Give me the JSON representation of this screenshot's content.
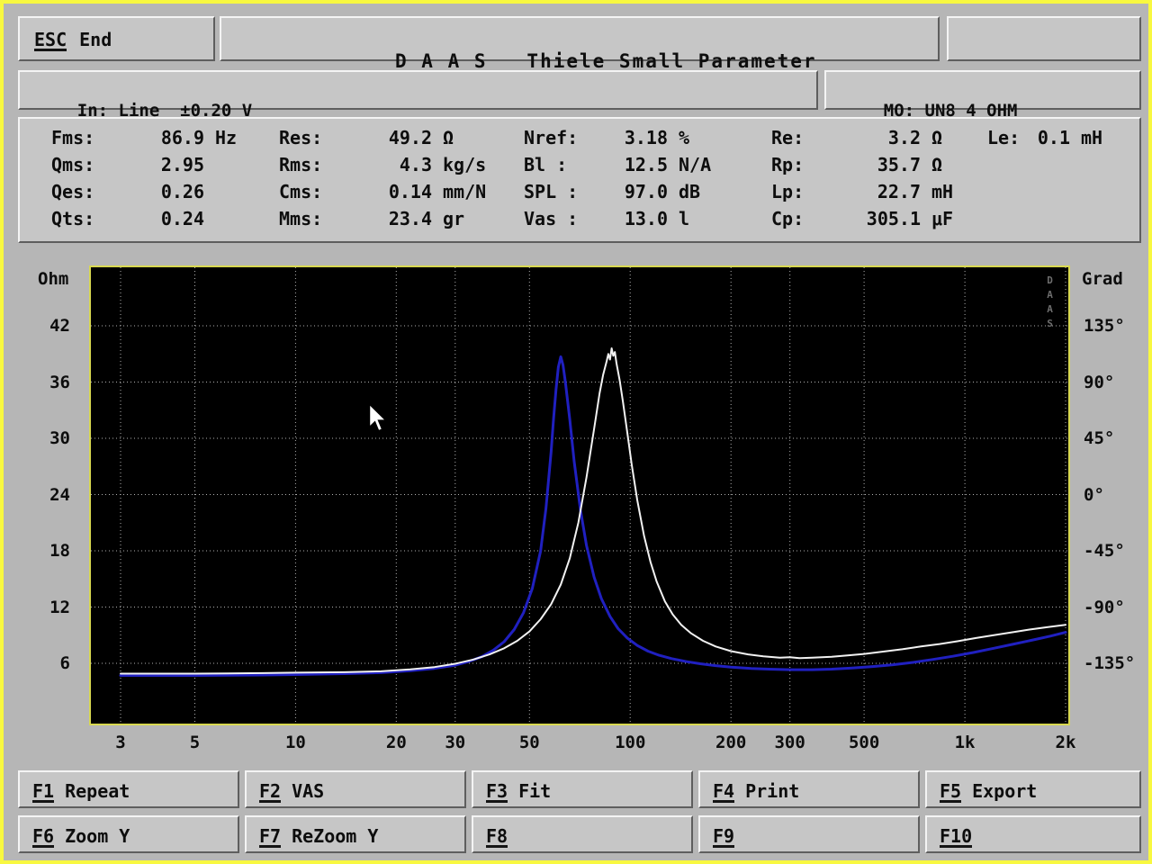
{
  "top": {
    "esc_key": "ESC",
    "esc_label": "End",
    "title": "D A A S   Thiele Small Parameter"
  },
  "status": {
    "input": "In: Line  ±0.20 V",
    "mo_key": "MO",
    "mo_rest": ": UN8 4 OHM"
  },
  "parameters": {
    "rows": [
      [
        {
          "label": "Fms:",
          "value": "86.9",
          "unit": "Hz"
        },
        {
          "label": "Res:",
          "value": "49.2",
          "unit": "Ω"
        },
        {
          "label": "Nref:",
          "value": "3.18",
          "unit": "%"
        },
        {
          "label": "Re:",
          "value": "3.2",
          "unit": "Ω"
        },
        {
          "label": "Le:",
          "value": "0.1",
          "unit": "mH"
        }
      ],
      [
        {
          "label": "Qms:",
          "value": "2.95",
          "unit": ""
        },
        {
          "label": "Rms:",
          "value": "4.3",
          "unit": "kg/s"
        },
        {
          "label": "Bl :",
          "value": "12.5",
          "unit": "N/A"
        },
        {
          "label": "Rp:",
          "value": "35.7",
          "unit": "Ω"
        }
      ],
      [
        {
          "label": "Qes:",
          "value": "0.26",
          "unit": ""
        },
        {
          "label": "Cms:",
          "value": "0.14",
          "unit": "mm/N"
        },
        {
          "label": "SPL :",
          "value": "97.0",
          "unit": "dB"
        },
        {
          "label": "Lp:",
          "value": "22.7",
          "unit": "mH"
        }
      ],
      [
        {
          "label": "Qts:",
          "value": "0.24",
          "unit": ""
        },
        {
          "label": "Mms:",
          "value": "23.4",
          "unit": "gr"
        },
        {
          "label": "Vas :",
          "value": "13.0",
          "unit": "l"
        },
        {
          "label": "Cp:",
          "value": "305.1",
          "unit": "μF"
        }
      ]
    ]
  },
  "fkeys": {
    "row1": [
      {
        "key": "F1",
        "label": "Repeat"
      },
      {
        "key": "F2",
        "label": "VAS"
      },
      {
        "key": "F3",
        "label": "Fit"
      },
      {
        "key": "F4",
        "label": "Print"
      },
      {
        "key": "F5",
        "label": "Export"
      }
    ],
    "row2": [
      {
        "key": "F6",
        "label": "Zoom Y"
      },
      {
        "key": "F7",
        "label": "ReZoom Y"
      },
      {
        "key": "F8",
        "label": ""
      },
      {
        "key": "F9",
        "label": ""
      },
      {
        "key": "F10",
        "label": ""
      }
    ]
  },
  "chart_data": {
    "type": "line",
    "x_scale": "log",
    "x_min": 3,
    "x_max": 2000,
    "x_ticks": [
      {
        "label": "3",
        "value": 3
      },
      {
        "label": "5",
        "value": 5
      },
      {
        "label": "10",
        "value": 10
      },
      {
        "label": "20",
        "value": 20
      },
      {
        "label": "30",
        "value": 30
      },
      {
        "label": "50",
        "value": 50
      },
      {
        "label": "100",
        "value": 100
      },
      {
        "label": "200",
        "value": 200
      },
      {
        "label": "300",
        "value": 300
      },
      {
        "label": "500",
        "value": 500
      },
      {
        "label": "1k",
        "value": 1000
      },
      {
        "label": "2k",
        "value": 2000
      }
    ],
    "y_left": {
      "label": "Ohm",
      "ticks": [
        42,
        36,
        30,
        24,
        18,
        12,
        6
      ],
      "ylim": [
        0,
        48.2
      ]
    },
    "y_right": {
      "label": "Grad",
      "ticks": [
        "135°",
        "90°",
        "45°",
        "0°",
        "-45°",
        "-90°",
        "-135°"
      ]
    },
    "watermark": "DAAS",
    "colors": {
      "plot_bg": "#000000",
      "grid": "#b0b0b0",
      "frame": "#d8d850",
      "blue": "#2020c0",
      "white": "#f2f2f2"
    },
    "series": [
      {
        "name": "impedance-added-mass",
        "color": "#2020c0",
        "width": 3,
        "points": [
          [
            3,
            4.7
          ],
          [
            5,
            4.7
          ],
          [
            8,
            4.75
          ],
          [
            10,
            4.8
          ],
          [
            14,
            4.9
          ],
          [
            18,
            5.0
          ],
          [
            22,
            5.2
          ],
          [
            26,
            5.45
          ],
          [
            30,
            5.8
          ],
          [
            33,
            6.2
          ],
          [
            36,
            6.7
          ],
          [
            39,
            7.4
          ],
          [
            42,
            8.3
          ],
          [
            45,
            9.6
          ],
          [
            48,
            11.4
          ],
          [
            51,
            14.0
          ],
          [
            54,
            18.0
          ],
          [
            56,
            22.5
          ],
          [
            58,
            28.5
          ],
          [
            59,
            32.0
          ],
          [
            60,
            35.2
          ],
          [
            61,
            37.6
          ],
          [
            62,
            38.7
          ],
          [
            63,
            37.8
          ],
          [
            64,
            36.0
          ],
          [
            66,
            32.0
          ],
          [
            68,
            27.5
          ],
          [
            71,
            22.4
          ],
          [
            74,
            18.6
          ],
          [
            78,
            15.2
          ],
          [
            82,
            12.9
          ],
          [
            87,
            11.0
          ],
          [
            92,
            9.7
          ],
          [
            98,
            8.7
          ],
          [
            105,
            7.9
          ],
          [
            113,
            7.3
          ],
          [
            122,
            6.85
          ],
          [
            133,
            6.5
          ],
          [
            146,
            6.2
          ],
          [
            162,
            5.95
          ],
          [
            180,
            5.75
          ],
          [
            200,
            5.6
          ],
          [
            230,
            5.45
          ],
          [
            260,
            5.38
          ],
          [
            300,
            5.32
          ],
          [
            350,
            5.32
          ],
          [
            400,
            5.38
          ],
          [
            460,
            5.5
          ],
          [
            530,
            5.65
          ],
          [
            610,
            5.85
          ],
          [
            700,
            6.1
          ],
          [
            800,
            6.4
          ],
          [
            920,
            6.75
          ],
          [
            1060,
            7.15
          ],
          [
            1220,
            7.6
          ],
          [
            1400,
            8.05
          ],
          [
            1600,
            8.5
          ],
          [
            1800,
            8.9
          ],
          [
            2000,
            9.3
          ]
        ]
      },
      {
        "name": "impedance-free-air",
        "color": "#f2f2f2",
        "width": 2,
        "points": [
          [
            3,
            4.9
          ],
          [
            5,
            4.9
          ],
          [
            8,
            4.95
          ],
          [
            10,
            5.0
          ],
          [
            14,
            5.05
          ],
          [
            18,
            5.15
          ],
          [
            22,
            5.35
          ],
          [
            26,
            5.6
          ],
          [
            30,
            5.95
          ],
          [
            34,
            6.4
          ],
          [
            38,
            6.95
          ],
          [
            42,
            7.6
          ],
          [
            46,
            8.4
          ],
          [
            50,
            9.4
          ],
          [
            54,
            10.7
          ],
          [
            58,
            12.3
          ],
          [
            62,
            14.4
          ],
          [
            66,
            17.2
          ],
          [
            70,
            21.0
          ],
          [
            74,
            25.8
          ],
          [
            78,
            31.0
          ],
          [
            81,
            34.8
          ],
          [
            83,
            36.8
          ],
          [
            85,
            38.2
          ],
          [
            86,
            39.0
          ],
          [
            87,
            38.4
          ],
          [
            88,
            39.6
          ],
          [
            89,
            38.8
          ],
          [
            90,
            39.2
          ],
          [
            91,
            38.0
          ],
          [
            93,
            36.2
          ],
          [
            95,
            34.0
          ],
          [
            98,
            30.6
          ],
          [
            101,
            27.2
          ],
          [
            105,
            23.4
          ],
          [
            110,
            19.6
          ],
          [
            115,
            16.8
          ],
          [
            120,
            14.7
          ],
          [
            127,
            12.6
          ],
          [
            134,
            11.2
          ],
          [
            142,
            10.1
          ],
          [
            152,
            9.2
          ],
          [
            165,
            8.4
          ],
          [
            180,
            7.8
          ],
          [
            200,
            7.3
          ],
          [
            225,
            6.95
          ],
          [
            250,
            6.75
          ],
          [
            280,
            6.6
          ],
          [
            300,
            6.65
          ],
          [
            320,
            6.55
          ],
          [
            350,
            6.6
          ],
          [
            400,
            6.7
          ],
          [
            450,
            6.85
          ],
          [
            500,
            7.0
          ],
          [
            570,
            7.25
          ],
          [
            650,
            7.5
          ],
          [
            740,
            7.8
          ],
          [
            840,
            8.05
          ],
          [
            950,
            8.35
          ],
          [
            1080,
            8.7
          ],
          [
            1220,
            9.0
          ],
          [
            1380,
            9.3
          ],
          [
            1560,
            9.6
          ],
          [
            1760,
            9.85
          ],
          [
            2000,
            10.1
          ]
        ]
      }
    ]
  }
}
